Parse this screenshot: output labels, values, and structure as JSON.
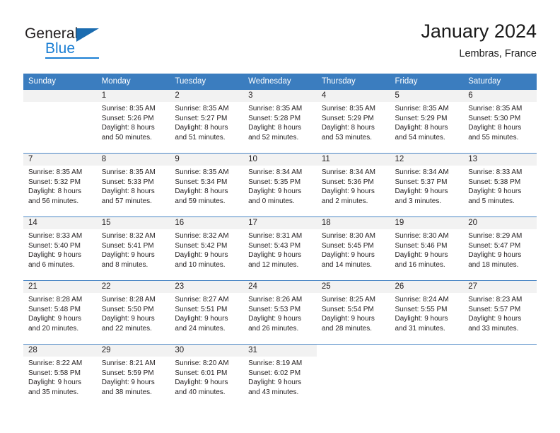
{
  "brand": {
    "name_part1": "General",
    "name_part2": "Blue"
  },
  "header": {
    "title": "January 2024",
    "location": "Lembras, France"
  },
  "calendar": {
    "weekday_headers": [
      "Sunday",
      "Monday",
      "Tuesday",
      "Wednesday",
      "Thursday",
      "Friday",
      "Saturday"
    ],
    "colors": {
      "header_background": "#3b7dbf",
      "header_text": "#ffffff",
      "daynum_band": "#f2f2f2",
      "row_separator": "#4a86c5",
      "brand_blue": "#1b7fd4",
      "logo_triangle": "#1b6cb0",
      "text": "#231f20"
    },
    "weeks": [
      [
        {
          "day": "",
          "lines": []
        },
        {
          "day": "1",
          "lines": [
            "Sunrise: 8:35 AM",
            "Sunset: 5:26 PM",
            "Daylight: 8 hours",
            "and 50 minutes."
          ]
        },
        {
          "day": "2",
          "lines": [
            "Sunrise: 8:35 AM",
            "Sunset: 5:27 PM",
            "Daylight: 8 hours",
            "and 51 minutes."
          ]
        },
        {
          "day": "3",
          "lines": [
            "Sunrise: 8:35 AM",
            "Sunset: 5:28 PM",
            "Daylight: 8 hours",
            "and 52 minutes."
          ]
        },
        {
          "day": "4",
          "lines": [
            "Sunrise: 8:35 AM",
            "Sunset: 5:29 PM",
            "Daylight: 8 hours",
            "and 53 minutes."
          ]
        },
        {
          "day": "5",
          "lines": [
            "Sunrise: 8:35 AM",
            "Sunset: 5:29 PM",
            "Daylight: 8 hours",
            "and 54 minutes."
          ]
        },
        {
          "day": "6",
          "lines": [
            "Sunrise: 8:35 AM",
            "Sunset: 5:30 PM",
            "Daylight: 8 hours",
            "and 55 minutes."
          ]
        }
      ],
      [
        {
          "day": "7",
          "lines": [
            "Sunrise: 8:35 AM",
            "Sunset: 5:32 PM",
            "Daylight: 8 hours",
            "and 56 minutes."
          ]
        },
        {
          "day": "8",
          "lines": [
            "Sunrise: 8:35 AM",
            "Sunset: 5:33 PM",
            "Daylight: 8 hours",
            "and 57 minutes."
          ]
        },
        {
          "day": "9",
          "lines": [
            "Sunrise: 8:35 AM",
            "Sunset: 5:34 PM",
            "Daylight: 8 hours",
            "and 59 minutes."
          ]
        },
        {
          "day": "10",
          "lines": [
            "Sunrise: 8:34 AM",
            "Sunset: 5:35 PM",
            "Daylight: 9 hours",
            "and 0 minutes."
          ]
        },
        {
          "day": "11",
          "lines": [
            "Sunrise: 8:34 AM",
            "Sunset: 5:36 PM",
            "Daylight: 9 hours",
            "and 2 minutes."
          ]
        },
        {
          "day": "12",
          "lines": [
            "Sunrise: 8:34 AM",
            "Sunset: 5:37 PM",
            "Daylight: 9 hours",
            "and 3 minutes."
          ]
        },
        {
          "day": "13",
          "lines": [
            "Sunrise: 8:33 AM",
            "Sunset: 5:38 PM",
            "Daylight: 9 hours",
            "and 5 minutes."
          ]
        }
      ],
      [
        {
          "day": "14",
          "lines": [
            "Sunrise: 8:33 AM",
            "Sunset: 5:40 PM",
            "Daylight: 9 hours",
            "and 6 minutes."
          ]
        },
        {
          "day": "15",
          "lines": [
            "Sunrise: 8:32 AM",
            "Sunset: 5:41 PM",
            "Daylight: 9 hours",
            "and 8 minutes."
          ]
        },
        {
          "day": "16",
          "lines": [
            "Sunrise: 8:32 AM",
            "Sunset: 5:42 PM",
            "Daylight: 9 hours",
            "and 10 minutes."
          ]
        },
        {
          "day": "17",
          "lines": [
            "Sunrise: 8:31 AM",
            "Sunset: 5:43 PM",
            "Daylight: 9 hours",
            "and 12 minutes."
          ]
        },
        {
          "day": "18",
          "lines": [
            "Sunrise: 8:30 AM",
            "Sunset: 5:45 PM",
            "Daylight: 9 hours",
            "and 14 minutes."
          ]
        },
        {
          "day": "19",
          "lines": [
            "Sunrise: 8:30 AM",
            "Sunset: 5:46 PM",
            "Daylight: 9 hours",
            "and 16 minutes."
          ]
        },
        {
          "day": "20",
          "lines": [
            "Sunrise: 8:29 AM",
            "Sunset: 5:47 PM",
            "Daylight: 9 hours",
            "and 18 minutes."
          ]
        }
      ],
      [
        {
          "day": "21",
          "lines": [
            "Sunrise: 8:28 AM",
            "Sunset: 5:48 PM",
            "Daylight: 9 hours",
            "and 20 minutes."
          ]
        },
        {
          "day": "22",
          "lines": [
            "Sunrise: 8:28 AM",
            "Sunset: 5:50 PM",
            "Daylight: 9 hours",
            "and 22 minutes."
          ]
        },
        {
          "day": "23",
          "lines": [
            "Sunrise: 8:27 AM",
            "Sunset: 5:51 PM",
            "Daylight: 9 hours",
            "and 24 minutes."
          ]
        },
        {
          "day": "24",
          "lines": [
            "Sunrise: 8:26 AM",
            "Sunset: 5:53 PM",
            "Daylight: 9 hours",
            "and 26 minutes."
          ]
        },
        {
          "day": "25",
          "lines": [
            "Sunrise: 8:25 AM",
            "Sunset: 5:54 PM",
            "Daylight: 9 hours",
            "and 28 minutes."
          ]
        },
        {
          "day": "26",
          "lines": [
            "Sunrise: 8:24 AM",
            "Sunset: 5:55 PM",
            "Daylight: 9 hours",
            "and 31 minutes."
          ]
        },
        {
          "day": "27",
          "lines": [
            "Sunrise: 8:23 AM",
            "Sunset: 5:57 PM",
            "Daylight: 9 hours",
            "and 33 minutes."
          ]
        }
      ],
      [
        {
          "day": "28",
          "lines": [
            "Sunrise: 8:22 AM",
            "Sunset: 5:58 PM",
            "Daylight: 9 hours",
            "and 35 minutes."
          ]
        },
        {
          "day": "29",
          "lines": [
            "Sunrise: 8:21 AM",
            "Sunset: 5:59 PM",
            "Daylight: 9 hours",
            "and 38 minutes."
          ]
        },
        {
          "day": "30",
          "lines": [
            "Sunrise: 8:20 AM",
            "Sunset: 6:01 PM",
            "Daylight: 9 hours",
            "and 40 minutes."
          ]
        },
        {
          "day": "31",
          "lines": [
            "Sunrise: 8:19 AM",
            "Sunset: 6:02 PM",
            "Daylight: 9 hours",
            "and 43 minutes."
          ]
        },
        {
          "day": "",
          "lines": []
        },
        {
          "day": "",
          "lines": []
        },
        {
          "day": "",
          "lines": []
        }
      ]
    ]
  }
}
